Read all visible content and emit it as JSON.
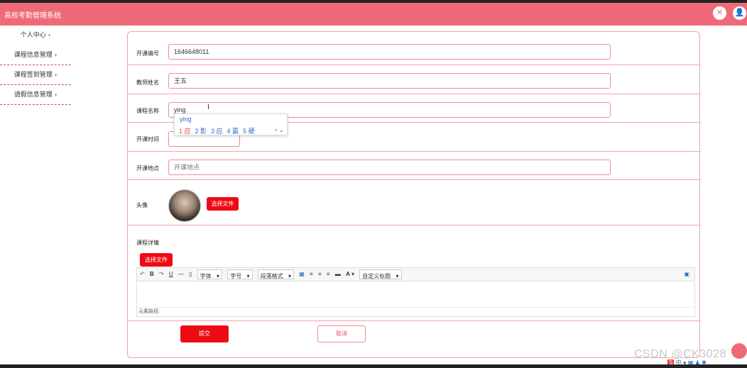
{
  "app": {
    "title": "高校考勤管理系统"
  },
  "topbar": {
    "close_icon": "close-icon",
    "user_icon": "user-icon"
  },
  "sidebar": {
    "items": [
      {
        "label": "个人中心"
      },
      {
        "label": "课程信息管理"
      },
      {
        "label": "课程签到管理"
      },
      {
        "label": "请假信息管理"
      }
    ]
  },
  "form": {
    "course_no": {
      "label": "开课编号",
      "value": "1646648011"
    },
    "teacher": {
      "label": "教师姓名",
      "value": "王五"
    },
    "course_name": {
      "label": "课程名称",
      "value": "ying"
    },
    "time": {
      "label": "开课时间",
      "value": ""
    },
    "location": {
      "label": "开课地点",
      "placeholder": "开课地点"
    },
    "avatar": {
      "label": "头像",
      "button": "选择文件"
    },
    "detail": {
      "label": "课程详情",
      "button": "选择文件"
    },
    "submit": "提交",
    "cancel": "取消"
  },
  "ime": {
    "input": "ying",
    "candidates": [
      "1 应",
      "2 影",
      "3 应",
      "4 赢",
      "5 硬"
    ],
    "nav": "› ⌄"
  },
  "editor": {
    "toolbar": {
      "font": "字体",
      "size": "字号",
      "paragraph": "段落格式",
      "custom_title": "自定义标题"
    },
    "path": "元素路径:"
  },
  "watermark": "CSDN @CK3028"
}
